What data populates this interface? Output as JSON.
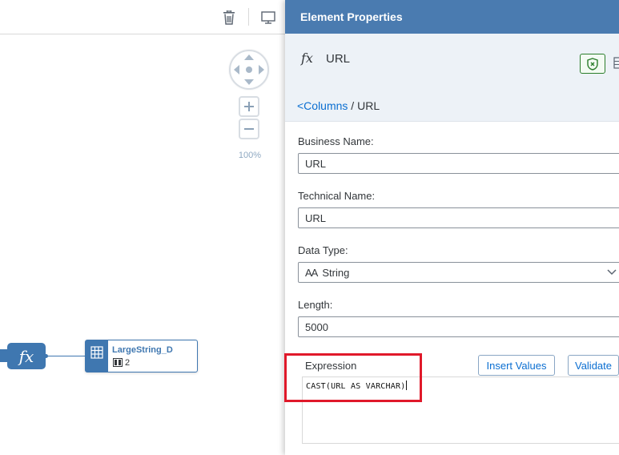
{
  "canvas": {
    "toolbar": {
      "delete_icon": "trash-icon",
      "preview_icon": "monitor-icon"
    },
    "navigation": {
      "pan_icon": "pan-arrows-icon",
      "zoom_in_icon": "plus-icon",
      "zoom_out_icon": "minus-icon",
      "zoom_level": "100%"
    },
    "nodes": {
      "calculated": {
        "label": "fx",
        "icon": "function-icon"
      },
      "table": {
        "name": "LargeString_D",
        "column_count": "2",
        "icon": "table-grid-icon"
      }
    }
  },
  "panel": {
    "title": "Element Properties",
    "element": {
      "icon_text": "fx",
      "name": "URL"
    },
    "breadcrumb": {
      "link": "<Columns",
      "separator": " / ",
      "current": "URL"
    },
    "fields": {
      "business_name": {
        "label": "Business Name:",
        "value": "URL"
      },
      "technical_name": {
        "label": "Technical Name:",
        "value": "URL"
      },
      "data_type": {
        "label": "Data Type:",
        "icon_text": "AA",
        "value": "String"
      },
      "length": {
        "label": "Length:",
        "value": "5000"
      }
    },
    "expression": {
      "label": "Expression",
      "insert_values": "Insert Values",
      "validate": "Validate",
      "text": "CAST(URL AS VARCHAR)"
    }
  },
  "colors": {
    "header_bg": "#4a7bb0",
    "node_blue": "#3f77b0",
    "link_blue": "#0a6ed1",
    "highlight_red": "#e0192a",
    "sub_bg": "#edf2f7"
  }
}
